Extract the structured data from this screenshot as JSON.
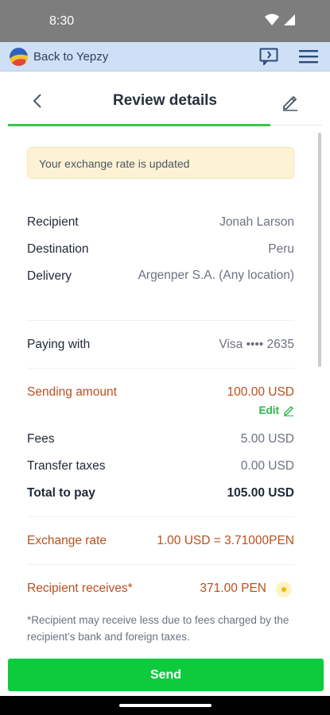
{
  "status_bar": {
    "time": "8:30"
  },
  "header": {
    "back_label": "Back to Yepzy",
    "icons": [
      "app-logo-icon",
      "feedback-icon",
      "hamburger-menu-icon"
    ]
  },
  "title_bar": {
    "title": "Review details"
  },
  "notice": {
    "text": "Your exchange rate is updated"
  },
  "details": {
    "recipient": {
      "label": "Recipient",
      "value": "Jonah Larson"
    },
    "destination": {
      "label": "Destination",
      "value": "Peru"
    },
    "delivery": {
      "label": "Delivery",
      "value": "Argenper S.A. (Any location)"
    },
    "paying_with": {
      "label": "Paying with",
      "value": "Visa •••• 2635"
    }
  },
  "amounts": {
    "sending": {
      "label": "Sending amount",
      "value": "100.00 USD",
      "edit_label": "Edit"
    },
    "fees": {
      "label": "Fees",
      "value": "5.00 USD"
    },
    "taxes": {
      "label": "Transfer taxes",
      "value": "0.00 USD"
    },
    "total": {
      "label": "Total to pay",
      "value": "105.00 USD"
    }
  },
  "exchange": {
    "rate": {
      "label": "Exchange rate",
      "value": "1.00 USD = 3.71000PEN"
    },
    "receives": {
      "label": "Recipient receives*",
      "value": "371.00 PEN"
    }
  },
  "footnote": "*Recipient may receive less due to fees charged by the recipient’s bank and foreign taxes.",
  "send_button": {
    "label": "Send"
  },
  "colors": {
    "accent": "#b8501d",
    "primary_green": "#0ecb3d",
    "notice_bg": "#fdf3d4",
    "header_bg": "#cfe0f6"
  }
}
